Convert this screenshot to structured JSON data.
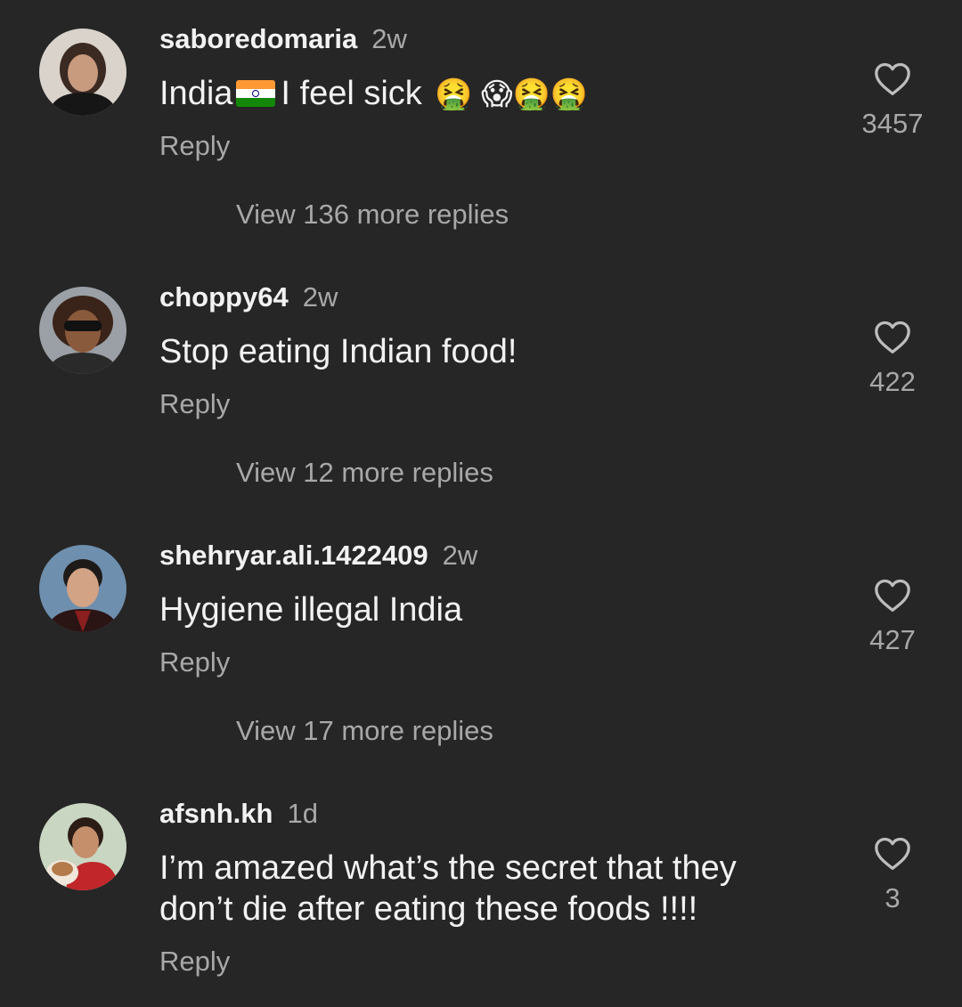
{
  "comments": [
    {
      "username": "saboredomaria",
      "time": "2w",
      "text": "India",
      "text_after_flag": "I feel sick",
      "emojis": "🤮 😱🤮🤮",
      "reply_label": "Reply",
      "likes": "3457",
      "view_more": "View 136 more replies"
    },
    {
      "username": "choppy64",
      "time": "2w",
      "text": "Stop eating Indian food!",
      "reply_label": "Reply",
      "likes": "422",
      "view_more": "View 12 more replies"
    },
    {
      "username": "shehryar.ali.1422409",
      "time": "2w",
      "text": "Hygiene illegal India",
      "reply_label": "Reply",
      "likes": "427",
      "view_more": "View 17 more replies"
    },
    {
      "username": "afsnh.kh",
      "time": "1d",
      "text_line1": "I’m amazed what’s the secret that they",
      "text_line2": "don’t die after eating these foods !!!!",
      "reply_label": "Reply",
      "likes": "3"
    }
  ],
  "colors": {
    "background": "#262626",
    "text_primary": "#f2f2f2",
    "text_secondary": "#a8a8a8"
  },
  "icons": [
    "heart-outline-icon",
    "india-flag-icon"
  ]
}
